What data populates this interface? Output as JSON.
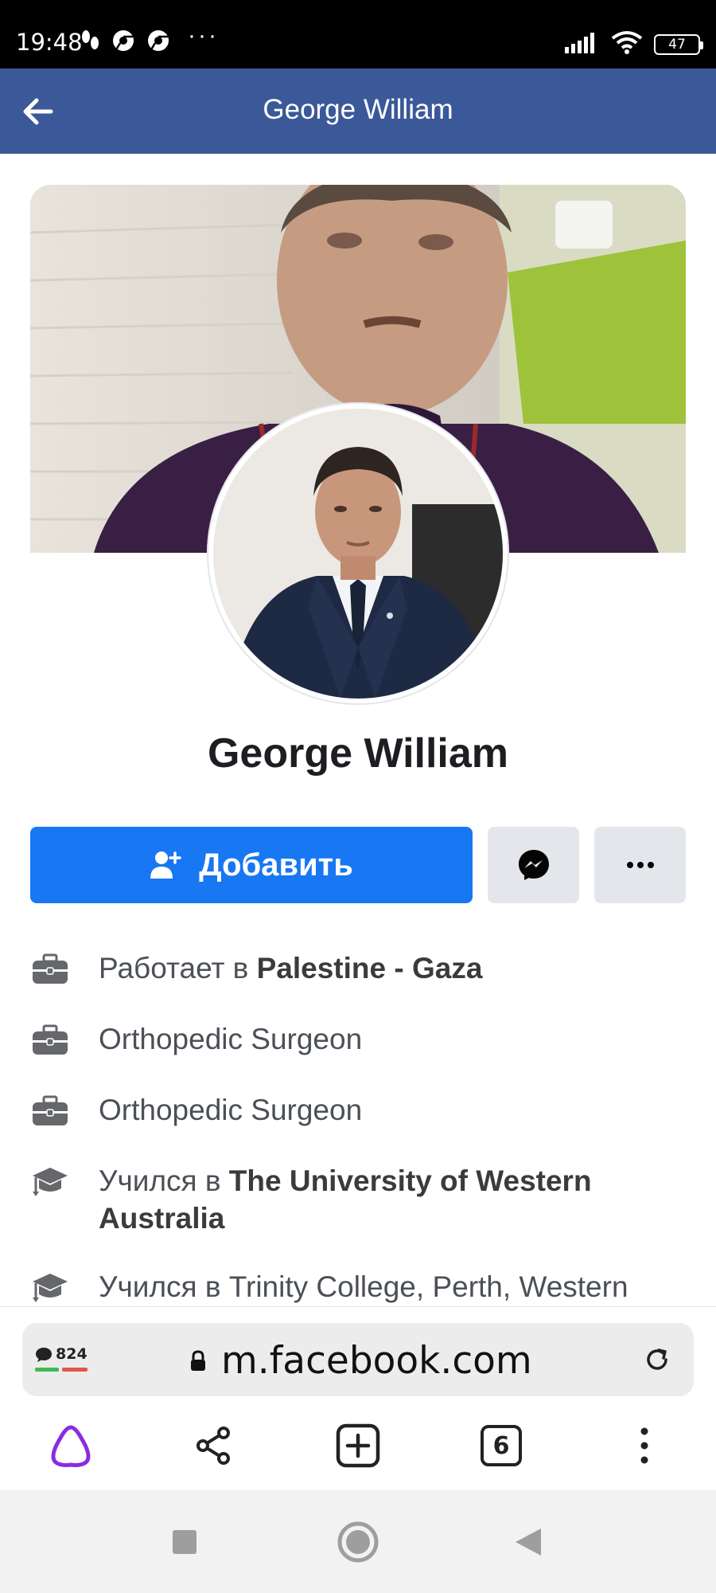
{
  "status_bar": {
    "time": "19:48",
    "battery": "47"
  },
  "header": {
    "title": "George William"
  },
  "profile": {
    "name": "George William"
  },
  "actions": {
    "add_label": "Добавить"
  },
  "info": [
    {
      "icon": "briefcase-icon",
      "prefix": "Работает в ",
      "bold": "Palestine - Gaza",
      "suffix": ""
    },
    {
      "icon": "briefcase-icon",
      "prefix": "Orthopedic Surgeon",
      "bold": "",
      "suffix": ""
    },
    {
      "icon": "briefcase-icon",
      "prefix": "Orthopedic Surgeon",
      "bold": "",
      "suffix": ""
    },
    {
      "icon": "graduation-cap-icon",
      "prefix": "Учился в ",
      "bold": "The University of Western Australia",
      "suffix": ""
    },
    {
      "icon": "graduation-cap-icon",
      "prefix": "Учился в Trinity College, Perth, Western",
      "bold": "",
      "suffix": ""
    }
  ],
  "browser": {
    "comment_count": "824",
    "url": "m.facebook.com",
    "tabs_count": "6"
  },
  "colors": {
    "header_blue": "#3b5998",
    "button_blue": "#1877f2",
    "secondary_gray": "#e4e6eb",
    "alice_purple": "#8a2be2"
  }
}
